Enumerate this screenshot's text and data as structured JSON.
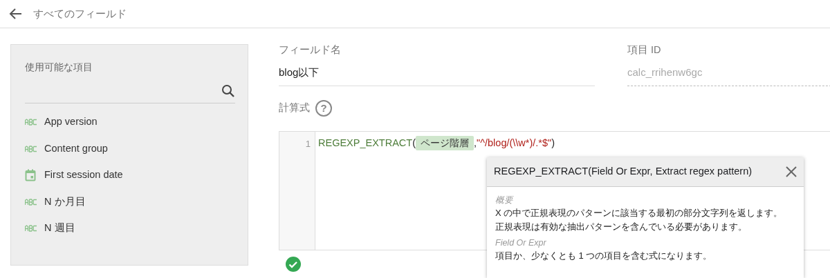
{
  "header": {
    "back_label": "すべてのフィールド"
  },
  "fields_panel": {
    "title": "使用可能な項目",
    "items": [
      {
        "kind": "text",
        "label": "App version"
      },
      {
        "kind": "text",
        "label": "Content group"
      },
      {
        "kind": "date",
        "label": "First session date"
      },
      {
        "kind": "text",
        "label": "N か月目"
      },
      {
        "kind": "text",
        "label": "N 週目"
      }
    ]
  },
  "field_name": {
    "label": "フィールド名",
    "value": "blog以下"
  },
  "field_id": {
    "label": "項目 ID",
    "value": "calc_rrihenw6gc",
    "disabled": true
  },
  "formula": {
    "label": "計算式",
    "help_icon": "?",
    "line_numbers": [
      "1"
    ],
    "tokens": [
      {
        "kind": "function",
        "text": "REGEXP_EXTRACT"
      },
      {
        "kind": "punct",
        "text": "("
      },
      {
        "kind": "field",
        "text": "ページ階層"
      },
      {
        "kind": "punct",
        "text": ","
      },
      {
        "kind": "string",
        "text": "\"^/blog/(\\\\w*)/.*$\""
      },
      {
        "kind": "punct",
        "text": ")"
      }
    ],
    "valid": true
  },
  "help_popup": {
    "signature": "REGEXP_EXTRACT(Field Or Expr, Extract regex pattern)",
    "sections": [
      {
        "heading": "概要",
        "lines": [
          "X の中で正規表現のパターンに該当する最初の部分文字列を返します。",
          "正規表現は有効な抽出パターンを含んでいる必要があります。"
        ]
      },
      {
        "heading": "Field Or Expr",
        "lines": [
          "項目か、少なくとも 1 つの項目を含む式になります。"
        ]
      }
    ]
  }
}
